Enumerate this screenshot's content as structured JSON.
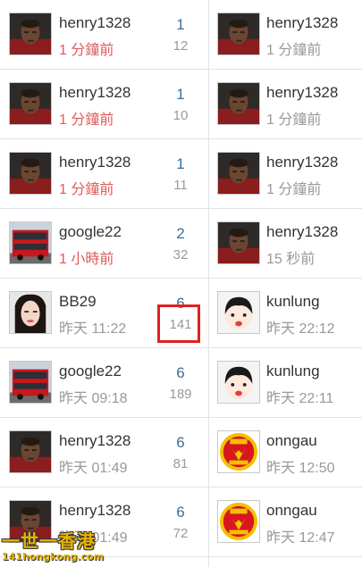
{
  "colors": {
    "reply_count": "#3d6e98",
    "recent_time": "#e05a5a",
    "muted": "#999999",
    "highlight": "#e02020",
    "divider": "#dfe3ea"
  },
  "rows": [
    {
      "author": {
        "name": "henry1328",
        "time": "1 分鐘前",
        "avatar": "man-avatar",
        "time_style": "red"
      },
      "replies": "1",
      "views": "12",
      "last_poster": {
        "name": "henry1328",
        "time": "1 分鐘前",
        "avatar": "man-avatar"
      }
    },
    {
      "author": {
        "name": "henry1328",
        "time": "1 分鐘前",
        "avatar": "man-avatar",
        "time_style": "red"
      },
      "replies": "1",
      "views": "10",
      "last_poster": {
        "name": "henry1328",
        "time": "1 分鐘前",
        "avatar": "man-avatar"
      }
    },
    {
      "author": {
        "name": "henry1328",
        "time": "1 分鐘前",
        "avatar": "man-avatar",
        "time_style": "red"
      },
      "replies": "1",
      "views": "11",
      "last_poster": {
        "name": "henry1328",
        "time": "1 分鐘前",
        "avatar": "man-avatar"
      }
    },
    {
      "author": {
        "name": "google22",
        "time": "1 小時前",
        "avatar": "bus-avatar",
        "time_style": "red"
      },
      "replies": "2",
      "views": "32",
      "last_poster": {
        "name": "henry1328",
        "time": "15 秒前",
        "avatar": "man-avatar"
      }
    },
    {
      "author": {
        "name": "BB29",
        "time": "昨天 11:22",
        "avatar": "woman-avatar",
        "time_style": "grey"
      },
      "replies": "6",
      "views": "141",
      "last_poster": {
        "name": "kunlung",
        "time": "昨天 22:12",
        "avatar": "cartoon-avatar"
      }
    },
    {
      "author": {
        "name": "google22",
        "time": "昨天 09:18",
        "avatar": "bus-avatar",
        "time_style": "grey"
      },
      "replies": "6",
      "views": "189",
      "last_poster": {
        "name": "kunlung",
        "time": "昨天 22:11",
        "avatar": "cartoon-avatar"
      }
    },
    {
      "author": {
        "name": "henry1328",
        "time": "昨天 01:49",
        "avatar": "man-avatar",
        "time_style": "grey"
      },
      "replies": "6",
      "views": "81",
      "last_poster": {
        "name": "onngau",
        "time": "昨天 12:50",
        "avatar": "crest-avatar"
      }
    },
    {
      "author": {
        "name": "henry1328",
        "time": "昨天 01:49",
        "avatar": "man-avatar",
        "time_style": "grey"
      },
      "replies": "6",
      "views": "72",
      "last_poster": {
        "name": "onngau",
        "time": "昨天 12:47",
        "avatar": "crest-avatar"
      }
    }
  ],
  "watermark": {
    "title": "一世一香港",
    "url": "141hongkong.com"
  }
}
